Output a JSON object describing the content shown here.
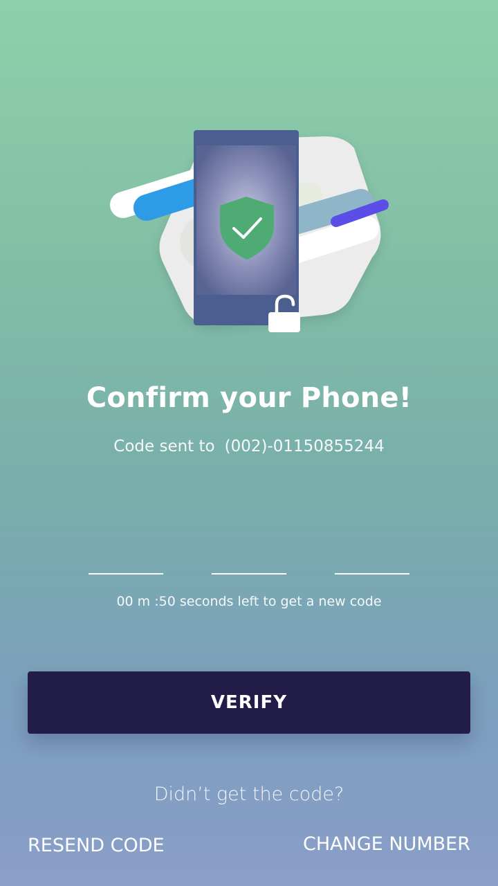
{
  "header": {
    "title": "Confirm your Phone!",
    "subtitle_prefix": "Code sent to",
    "phone_number": "(002)-01150855244"
  },
  "illustration": {
    "phone-icon": "phone-with-shield-check-icon",
    "lock": "unlocked-padlock-icon",
    "colors": {
      "phone_body": "#4a5f8f",
      "shield": "#4dab73",
      "blue_stripe": "#2e9be6",
      "purple_stripe": "#5a4ee6"
    }
  },
  "code_inputs": [
    {
      "value": "",
      "placeholder": ""
    },
    {
      "value": "",
      "placeholder": ""
    },
    {
      "value": "",
      "placeholder": ""
    }
  ],
  "timer_text": "00 m :50 seconds left to get a new code",
  "verify_label": "VERIFY",
  "help_text": "Didn’t get the code?",
  "resend_label": "RESEND CODE",
  "change_number_label": "CHANGE NUMBER",
  "colors": {
    "button_bg": "#221c48",
    "text": "#ffffff"
  }
}
